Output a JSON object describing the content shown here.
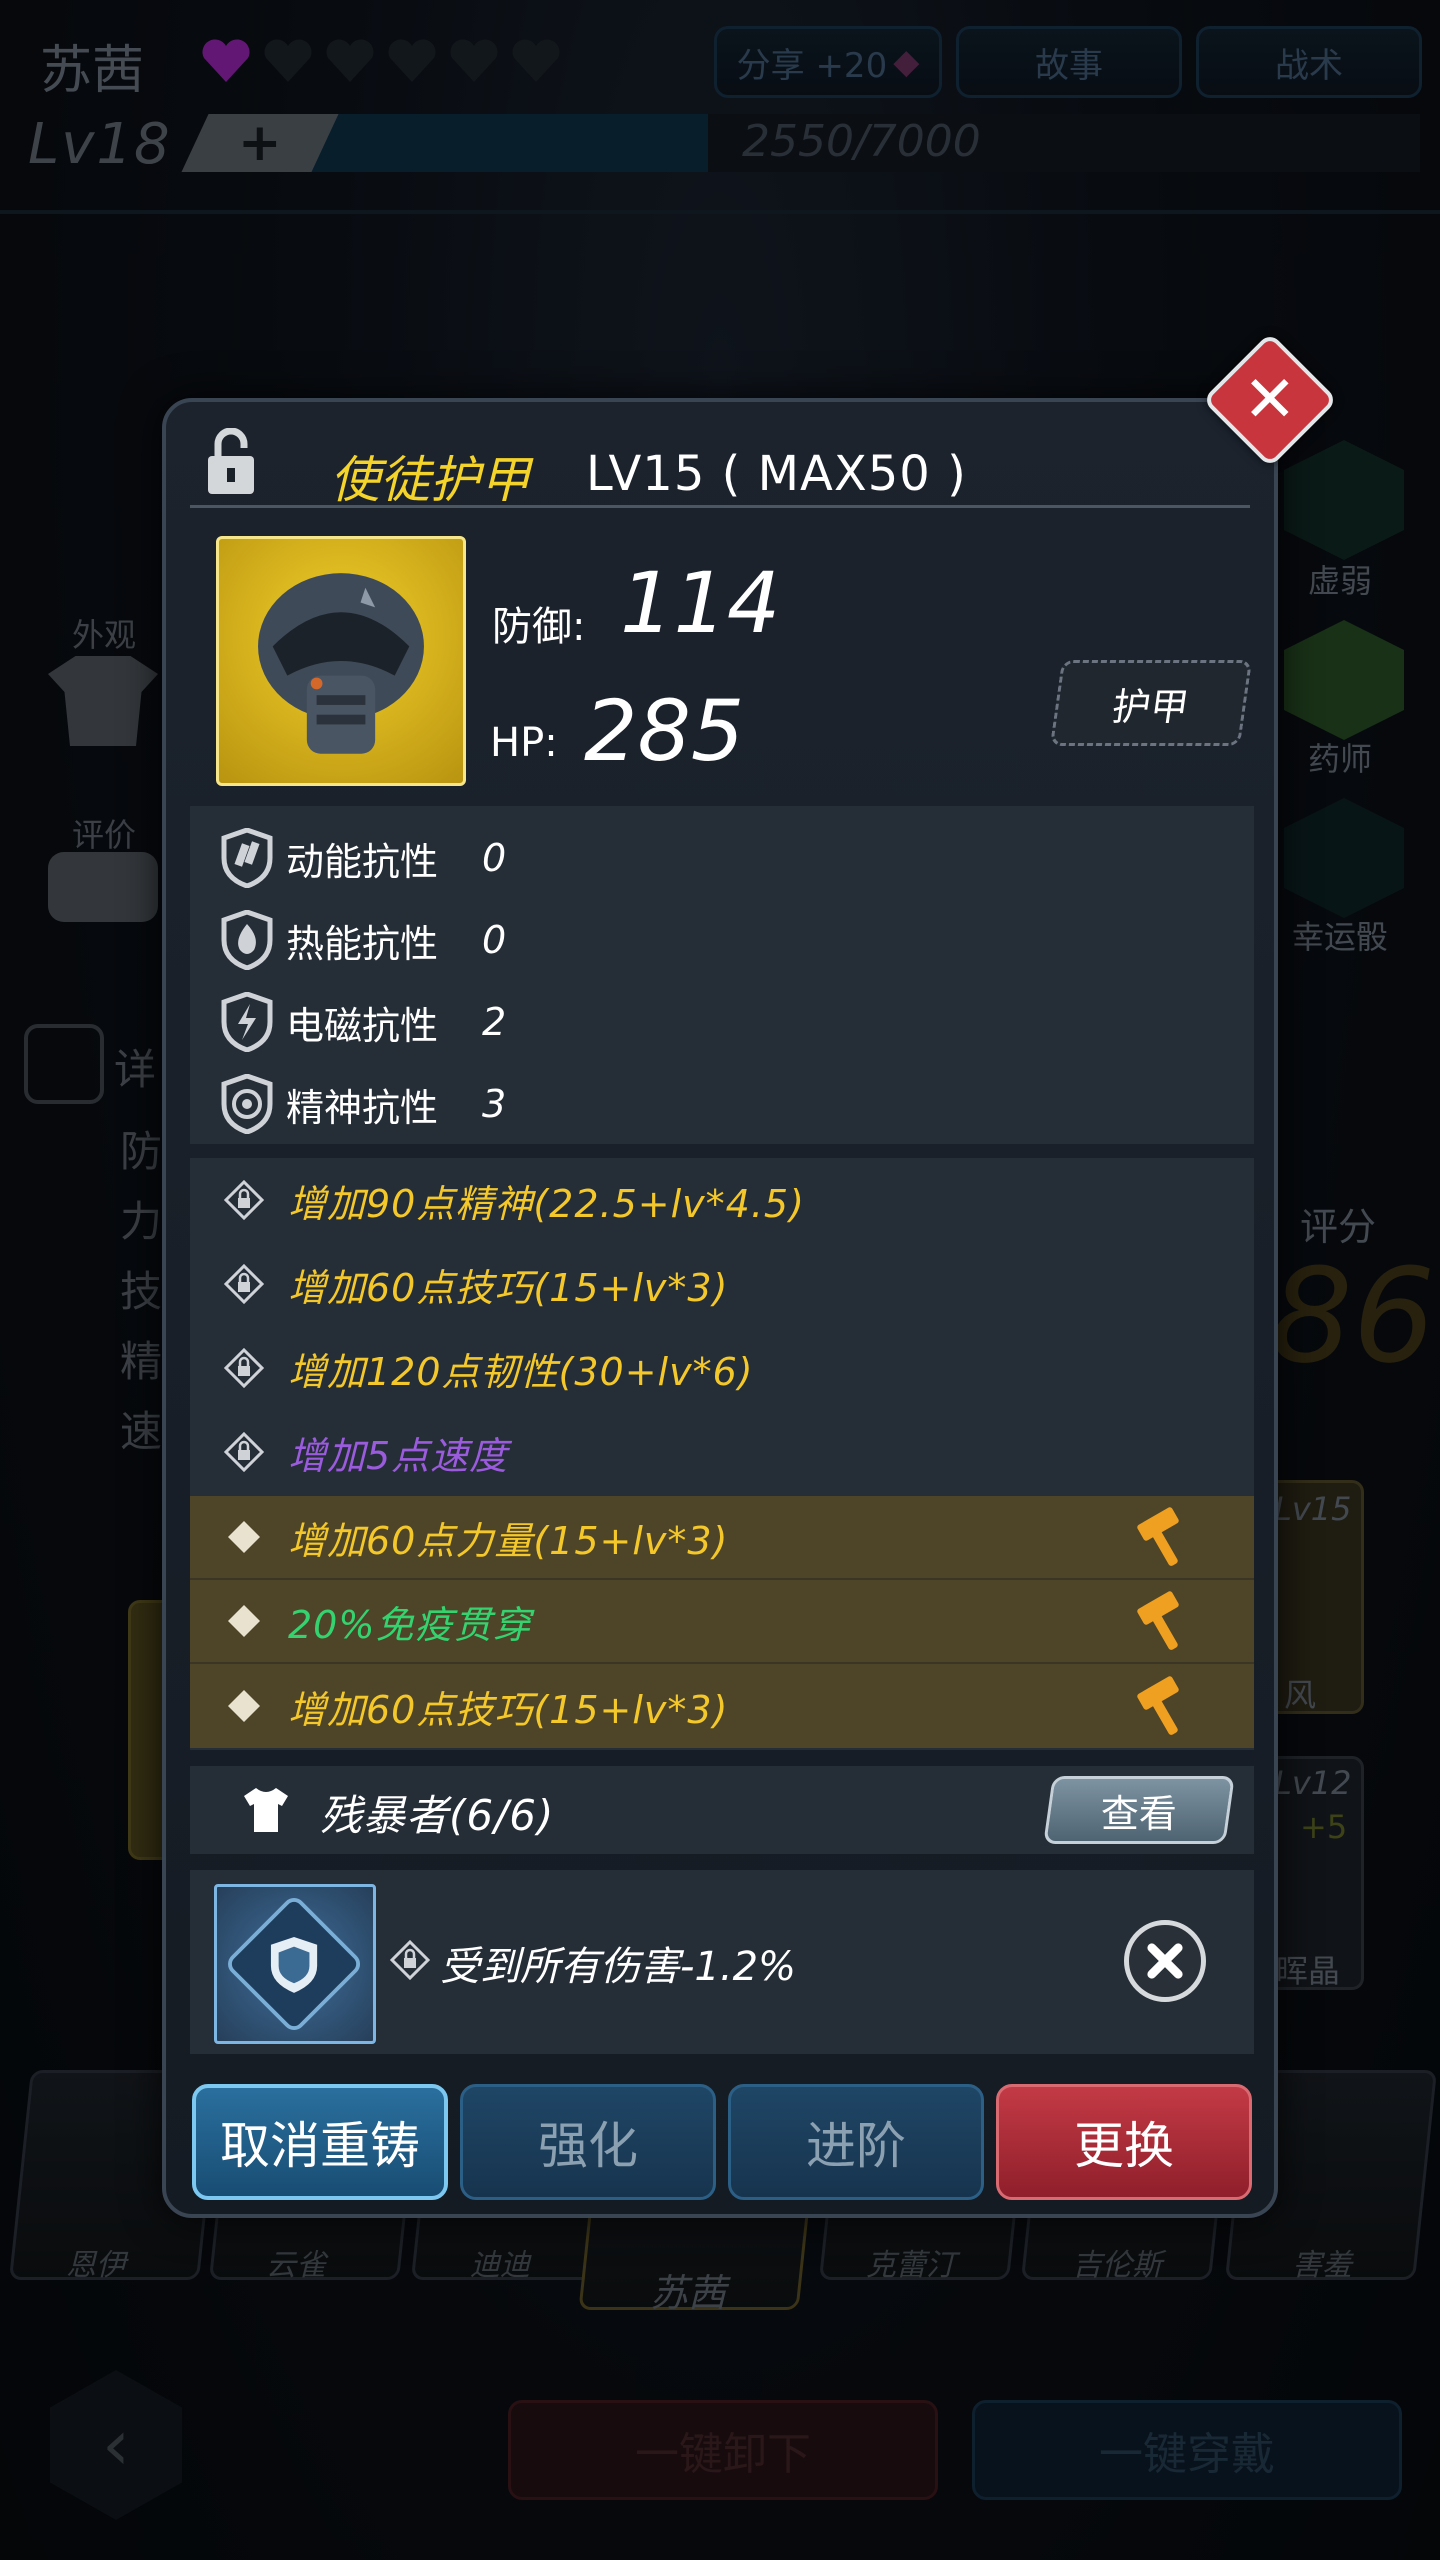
{
  "header": {
    "character_name": "苏茜",
    "hearts_total": 6,
    "hearts_filled": 1,
    "share_label": "分享 +20",
    "story_label": "故事",
    "tactics_label": "战术",
    "level_label": "Lv18",
    "plus_label": "+",
    "exp_text": "2550/7000",
    "exp_progress": 0.364
  },
  "background": {
    "left_labels": {
      "appearance": "外观",
      "review": "评价",
      "detail": "详",
      "defense": "防",
      "power": "力",
      "skill": "技",
      "spirit": "精",
      "speed": "速"
    },
    "right_labels": {
      "weak": "虚弱",
      "pharmacist": "药师",
      "lucky_dice": "幸运骰",
      "score": "评分",
      "score_value": "86",
      "lv15": "Lv15",
      "feng": "风",
      "lv12": "Lv12",
      "plus5": "+5",
      "crystal": "晖晶"
    }
  },
  "heroes": {
    "names": [
      "恩伊",
      "云雀",
      "迪迪",
      "苏茜",
      "克蕾汀",
      "吉伦斯",
      "害羞"
    ]
  },
  "bottom": {
    "back_symbol": "‹",
    "unequip_all": "一键卸下",
    "equip_all": "一键穿戴"
  },
  "modal": {
    "close_symbol": "✕",
    "item_name": "使徒护甲",
    "item_level": "LV15 ( MAX50 )",
    "defense_label": "防御:",
    "defense_value": "114",
    "hp_label": "HP:",
    "hp_value": "285",
    "type_tag": "护甲",
    "resistances": [
      {
        "label": "动能抗性",
        "value": "0",
        "icon": "kinetic-icon"
      },
      {
        "label": "热能抗性",
        "value": "0",
        "icon": "thermal-icon"
      },
      {
        "label": "电磁抗性",
        "value": "2",
        "icon": "em-icon"
      },
      {
        "label": "精神抗性",
        "value": "3",
        "icon": "psychic-icon"
      }
    ],
    "attributes": [
      {
        "text": "增加90点精神(22.5+lv*4.5)",
        "color": "#f4c82a",
        "reforged": false
      },
      {
        "text": "增加60点技巧(15+lv*3)",
        "color": "#f4c82a",
        "reforged": false
      },
      {
        "text": "增加120点韧性(30+lv*6)",
        "color": "#f4c82a",
        "reforged": false
      },
      {
        "text": "增加5点速度",
        "color": "#9a5bdc",
        "reforged": false
      },
      {
        "text": "增加60点力量(15+lv*3)",
        "color": "#f4c82a",
        "reforged": true
      },
      {
        "text": "20%免疫贯穿",
        "color": "#35d36f",
        "reforged": true
      },
      {
        "text": "增加60点技巧(15+lv*3)",
        "color": "#f4c82a",
        "reforged": true
      }
    ],
    "set_name": "残暴者(6/6)",
    "view_label": "查看",
    "chip_effect": "受到所有伤害-1.2%",
    "actions": {
      "cancel_reforge": "取消重铸",
      "enhance": "强化",
      "advance": "进阶",
      "replace": "更换"
    }
  },
  "colors": {
    "gold": "#f4c82a",
    "purple": "#9a5bdc",
    "green": "#35d36f",
    "reforge_bg": "#4e4528",
    "close_red": "#c8353c",
    "replace_red": "#b82c38",
    "blue_btn": "#1d4361"
  }
}
